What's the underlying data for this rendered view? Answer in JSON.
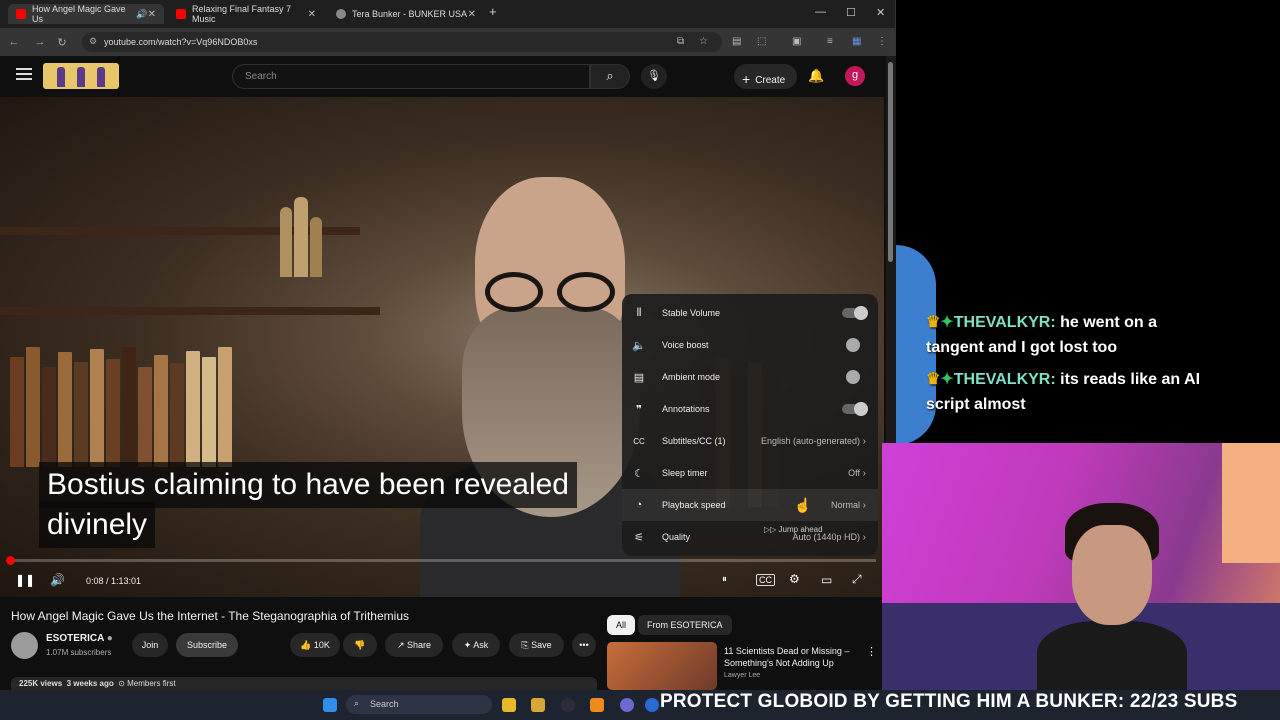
{
  "browser": {
    "tabs": [
      {
        "title": "How Angel Magic Gave Us",
        "color": "#ff0000",
        "active": true
      },
      {
        "title": "Relaxing Final Fantasy 7 Music",
        "color": "#ff0000",
        "active": false
      },
      {
        "title": "Tera Bunker - BUNKER USA",
        "color": "#888888",
        "active": false
      }
    ],
    "new_tab": "+",
    "close": "✕",
    "url": "youtube.com/watch?v=Vq96NDOB0xs"
  },
  "youtube": {
    "search_placeholder": "Search",
    "create_label": "Create",
    "avatar_letter": "g",
    "brand_color": "#ff0000"
  },
  "player": {
    "caption_line1": "Bostius claiming to have been revealed",
    "caption_line2": "divinely",
    "time": "0:08 / 1:13:01",
    "progress": 0.002,
    "settings": [
      {
        "label": "Stable Volume",
        "value": "",
        "toggle": "on",
        "icon": "stable-volume-icon"
      },
      {
        "label": "Voice boost",
        "value": "",
        "toggle": "off",
        "icon": "voice-boost-icon"
      },
      {
        "label": "Ambient mode",
        "value": "",
        "toggle": "off",
        "icon": "ambient-mode-icon"
      },
      {
        "label": "Annotations",
        "value": "",
        "toggle": "on",
        "icon": "annotations-icon"
      },
      {
        "label": "Subtitles/CC (1)",
        "value": "English (auto-generated)",
        "toggle": "",
        "icon": "subtitles-icon"
      },
      {
        "label": "Sleep timer",
        "value": "Off",
        "toggle": "",
        "icon": "sleep-timer-icon"
      },
      {
        "label": "Playback speed",
        "value": "Normal",
        "toggle": "",
        "icon": "playback-speed-icon"
      },
      {
        "label": "Quality",
        "value": "Auto (1440p HD)",
        "toggle": "",
        "icon": "quality-icon"
      }
    ],
    "jump_ahead": "Jump ahead"
  },
  "video": {
    "title": "How Angel Magic Gave Us the Internet - The Steganographia of Trithemius",
    "channel": "ESOTERICA",
    "subscribers": "1.07M subscribers",
    "join": "Join",
    "subscribe": "Subscribe",
    "likes": "10K",
    "share": "Share",
    "ask": "Ask",
    "save": "Save",
    "views": "225K views",
    "age": "3 weeks ago",
    "members": "Members first"
  },
  "related": {
    "chips": [
      "All",
      "From ESOTERICA"
    ],
    "item_title": "11 Scientists Dead or Missing – Something's Not Adding Up",
    "item_channel": "Lawyer Lee"
  },
  "chat": [
    {
      "user": "THEVALKYR:",
      "line1": " he went on a",
      "line2": "tangent and I got lost too"
    },
    {
      "user": "THEVALKYR:",
      "line1": " its reads like an AI",
      "line2": "script almost"
    }
  ],
  "taskbar": {
    "search": "Search",
    "banner": "PROTECT GLOBOID BY GETTING HIM A BUNKER: 22/23 SUBS"
  }
}
